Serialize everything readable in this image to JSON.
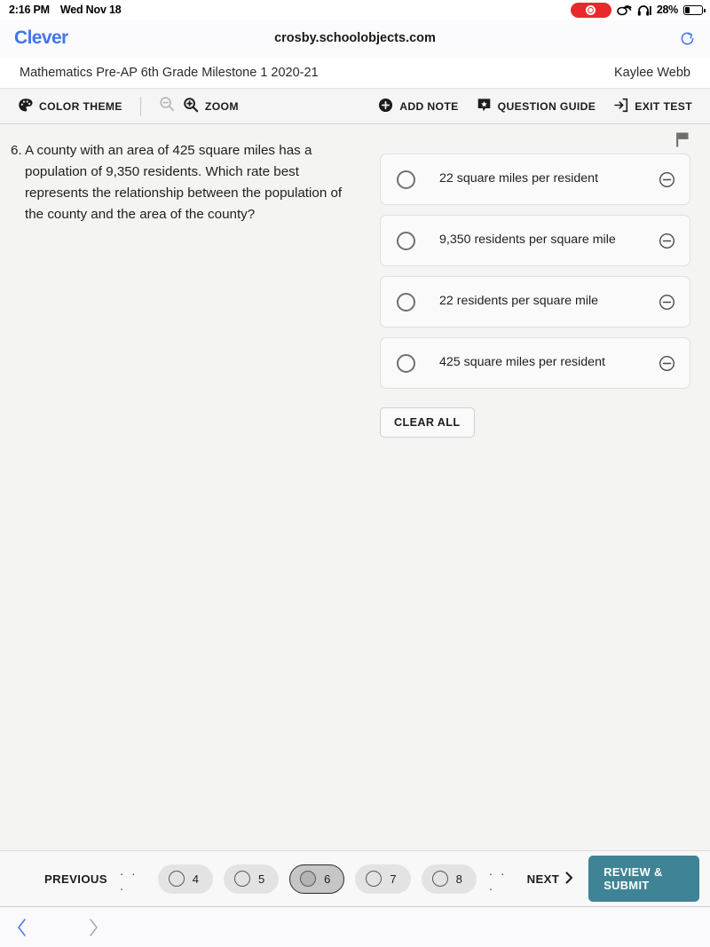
{
  "status_bar": {
    "time": "2:16 PM",
    "date": "Wed Nov 18",
    "recording_icon": "record-pill-icon",
    "link_icon": "link-chain-icon",
    "headphones_icon": "headphones-icon",
    "battery_percent": "28%",
    "battery_icon": "battery-icon"
  },
  "browser": {
    "logo_text": "Clever",
    "url": "crosby.schoolobjects.com",
    "reload_icon": "reload-icon",
    "back_icon": "chevron-left-icon",
    "forward_icon": "chevron-right-icon",
    "logo_color": "#4274f1"
  },
  "test_header": {
    "title": "Mathematics Pre-AP 6th Grade Milestone 1 2020-21",
    "user": "Kaylee Webb"
  },
  "toolbar": {
    "color_theme_label": "COLOR THEME",
    "color_theme_icon": "palette-icon",
    "zoom_out_icon": "magnifier-minus-icon",
    "zoom_in_icon": "magnifier-plus-icon",
    "zoom_label": "ZOOM",
    "add_note_label": "ADD NOTE",
    "add_note_icon": "plus-circle-icon",
    "question_guide_label": "QUESTION GUIDE",
    "question_guide_icon": "speech-bubble-star-icon",
    "exit_test_label": "EXIT TEST",
    "exit_test_icon": "exit-arrow-icon"
  },
  "question": {
    "number": "6.",
    "text": "6. A county with an area of 425 square miles has a population of 9,350 residents. Which rate best represents the relationship between the population of the county and the area of the county?",
    "flag_icon": "flag-icon",
    "options": [
      {
        "text": "22 square miles per resident",
        "radio_icon": "radio-unchecked-icon",
        "strike_icon": "circle-minus-icon",
        "selected": false
      },
      {
        "text": "9,350 residents per square mile",
        "radio_icon": "radio-unchecked-icon",
        "strike_icon": "circle-minus-icon",
        "selected": false
      },
      {
        "text": "22 residents per square mile",
        "radio_icon": "radio-unchecked-icon",
        "strike_icon": "circle-minus-icon",
        "selected": false
      },
      {
        "text": "425 square miles per resident",
        "radio_icon": "radio-unchecked-icon",
        "strike_icon": "circle-minus-icon",
        "selected": false
      }
    ],
    "clear_all_label": "CLEAR ALL"
  },
  "bottom_nav": {
    "previous_label": "PREVIOUS",
    "leading_ellipsis": ". . .",
    "pages": [
      {
        "number": "4",
        "active": false
      },
      {
        "number": "5",
        "active": false
      },
      {
        "number": "6",
        "active": true
      },
      {
        "number": "7",
        "active": false
      },
      {
        "number": "8",
        "active": false
      }
    ],
    "trailing_ellipsis": ". . .",
    "next_label": "NEXT",
    "next_icon": "chevron-right-icon",
    "submit_label": "REVIEW & SUBMIT",
    "submit_color": "#3f8496"
  }
}
